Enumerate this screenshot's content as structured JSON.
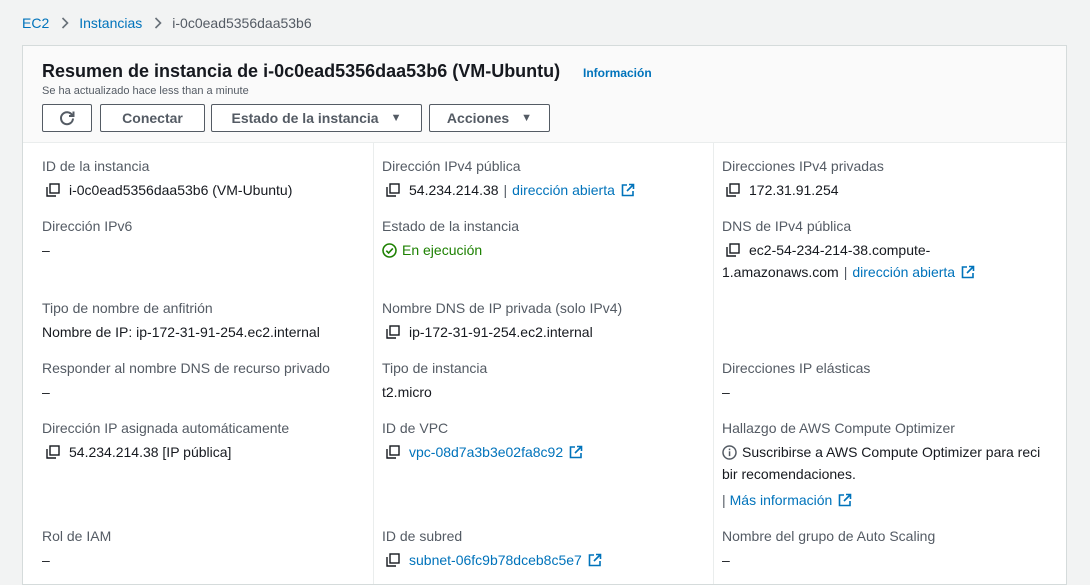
{
  "breadcrumb": {
    "items": [
      "EC2",
      "Instancias"
    ],
    "current": "i-0c0ead5356daa53b6"
  },
  "header": {
    "title": "Resumen de instancia de i-0c0ead5356daa53b6 (VM-Ubuntu)",
    "info_link": "Información",
    "updated": "Se ha actualizado hace less than a minute",
    "buttons": {
      "connect": "Conectar",
      "instance_state": "Estado de la instancia",
      "actions": "Acciones"
    }
  },
  "details": {
    "instance_id": {
      "label": "ID de la instancia",
      "value": "i-0c0ead5356daa53b6 (VM-Ubuntu)"
    },
    "public_ipv4": {
      "label": "Dirección IPv4 pública",
      "value": "54.234.214.38",
      "link": "dirección abierta"
    },
    "private_ipv4": {
      "label": "Direcciones IPv4 privadas",
      "value": "172.31.91.254"
    },
    "ipv6": {
      "label": "Dirección IPv6",
      "value": "–"
    },
    "instance_state": {
      "label": "Estado de la instancia",
      "value": "En ejecución"
    },
    "public_dns": {
      "label": "DNS de IPv4 pública",
      "value_line1": "ec2-54-234-214-38.compute-",
      "value_line2": "1.amazonaws.com",
      "link": "dirección abierta"
    },
    "hostname_type": {
      "label": "Tipo de nombre de anfitrión",
      "value": "Nombre de IP: ip-172-31-91-254.ec2.internal"
    },
    "private_dns": {
      "label": "Nombre DNS de IP privada (solo IPv4)",
      "value": "ip-172-31-91-254.ec2.internal"
    },
    "respond_private_dns": {
      "label": "Responder al nombre DNS de recurso privado",
      "value": "–"
    },
    "instance_type": {
      "label": "Tipo de instancia",
      "value": "t2.micro"
    },
    "elastic_ips": {
      "label": "Direcciones IP elásticas",
      "value": "–"
    },
    "auto_ip": {
      "label": "Dirección IP asignada automáticamente",
      "value": "54.234.214.38 [IP pública]"
    },
    "vpc_id": {
      "label": "ID de VPC",
      "value": "vpc-08d7a3b3e02fa8c92"
    },
    "compute_optimizer": {
      "label": "Hallazgo de AWS Compute Optimizer",
      "value_line1": "Suscribirse a AWS Compute Optimizer para reci",
      "value_line2": "bir recomendaciones.",
      "more_prefix": "|",
      "more_link": "Más información"
    },
    "iam_role": {
      "label": "Rol de IAM",
      "value": "–"
    },
    "subnet_id": {
      "label": "ID de subred",
      "value": "subnet-06fc9b78dceb8c5e7"
    },
    "asg_name": {
      "label": "Nombre del grupo de Auto Scaling",
      "value": "–"
    }
  }
}
